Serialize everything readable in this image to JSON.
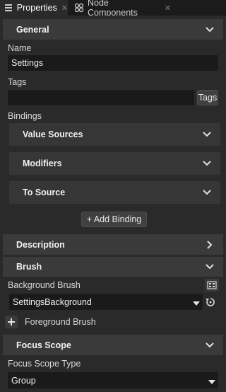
{
  "tabs": [
    {
      "label": "Properties",
      "icon": "properties-icon",
      "active": true
    },
    {
      "label": "Node Components",
      "icon": "node-components-icon",
      "active": false
    }
  ],
  "sections": {
    "general": {
      "title": "General",
      "expanded": true
    },
    "description": {
      "title": "Description",
      "expanded": false
    },
    "brush": {
      "title": "Brush",
      "expanded": true
    },
    "focus_scope": {
      "title": "Focus Scope",
      "expanded": true
    }
  },
  "general": {
    "name_label": "Name",
    "name_value": "Settings",
    "tags_label": "Tags",
    "tags_value": "",
    "tags_button": "Tags",
    "bindings_label": "Bindings",
    "bindings": [
      {
        "title": "Value Sources"
      },
      {
        "title": "Modifiers"
      },
      {
        "title": "To Source"
      }
    ],
    "add_binding_label": "+ Add Binding"
  },
  "brush": {
    "background_label": "Background Brush",
    "background_value": "SettingsBackground",
    "foreground_label": "Foreground Brush"
  },
  "focus_scope": {
    "type_label": "Focus Scope Type",
    "type_value": "Group"
  },
  "colors": {
    "background": "#2a2a2a",
    "section_header": "#3a3a3a",
    "input": "#1a1a1a",
    "text": "#dcdcdc"
  }
}
